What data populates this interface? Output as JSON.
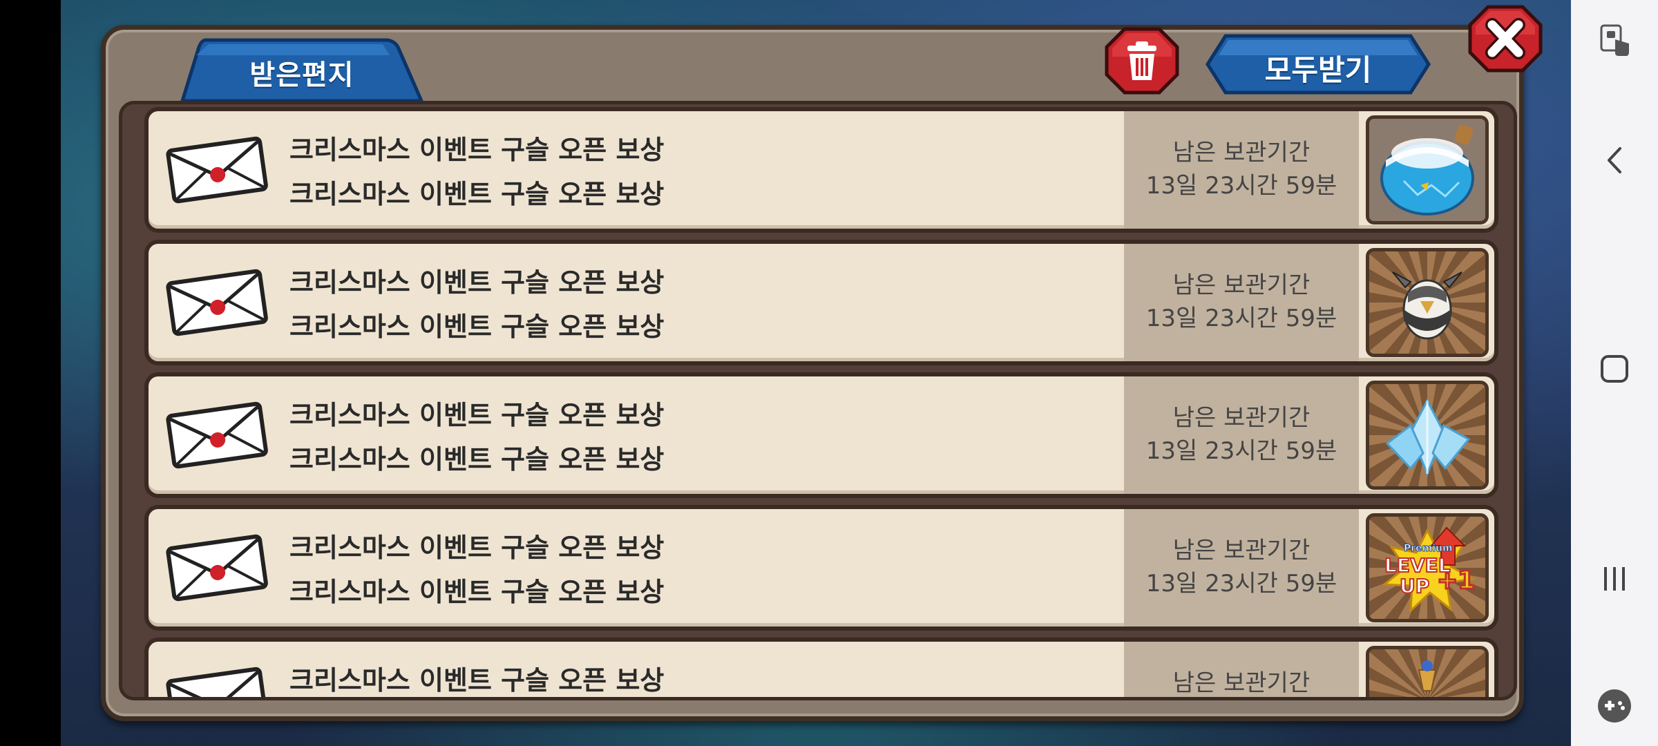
{
  "popup": {
    "tab_label": "받은편지",
    "receive_all_label": "모두받기"
  },
  "mails": [
    {
      "title": "크리스마스 이벤트 구슬 오픈 보상",
      "subtitle": "크리스마스 이벤트 구슬 오픈 보상",
      "expiry_label": "남은 보관기간",
      "expiry_time": "13일 23시간 59분",
      "reward_icon": "blue-potion-icon"
    },
    {
      "title": "크리스마스 이벤트 구슬 오픈 보상",
      "subtitle": "크리스마스 이벤트 구슬 오픈 보상",
      "expiry_label": "남은 보관기간",
      "expiry_time": "13일 23시간 59분",
      "reward_icon": "creature-egg-icon"
    },
    {
      "title": "크리스마스 이벤트 구슬 오픈 보상",
      "subtitle": "크리스마스 이벤트 구슬 오픈 보상",
      "expiry_label": "남은 보관기간",
      "expiry_time": "13일 23시간 59분",
      "reward_icon": "crystal-icon"
    },
    {
      "title": "크리스마스 이벤트 구슬 오픈 보상",
      "subtitle": "크리스마스 이벤트 구슬 오픈 보상",
      "expiry_label": "남은 보관기간",
      "expiry_time": "13일 23시간 59분",
      "reward_icon": "premium-level-up-icon",
      "reward_text": [
        "Premium",
        "LEVEL",
        "UP",
        "+1"
      ]
    },
    {
      "title": "크리스마스 이벤트 구슬 오픈 보상",
      "expiry_label": "남은 보관기간",
      "reward_icon": "lamp-icon"
    }
  ],
  "colors": {
    "blue_button": "#1e5fa8",
    "red_button": "#c8222a",
    "mail_bg": "#efe4d2",
    "frame": "#8a7b6f"
  }
}
